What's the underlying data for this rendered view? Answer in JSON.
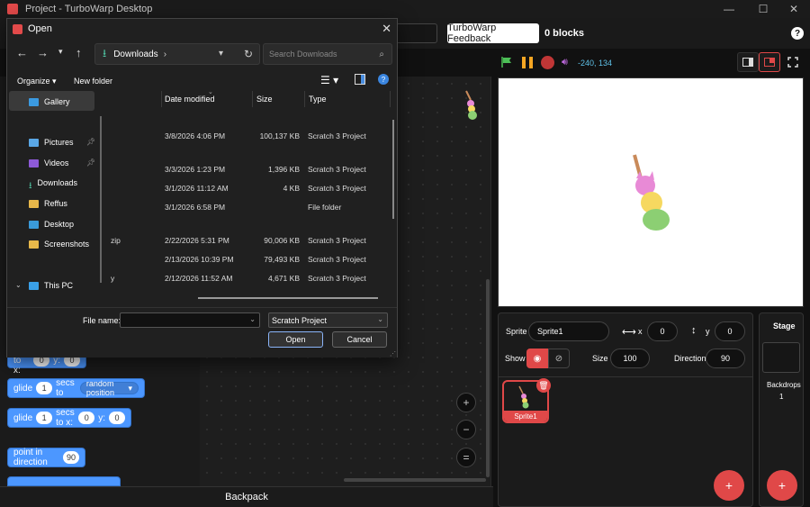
{
  "window": {
    "title": "Project - TurboWarp Desktop",
    "minimize": "—",
    "maximize": "☐",
    "close": "✕"
  },
  "menubar": {
    "feedback_label": "TurboWarp Feedback",
    "blocks_count": "0 blocks",
    "help": "?"
  },
  "stage_controls": {
    "coords": "-240, 134"
  },
  "blocks": [
    {
      "kind": "go-to-xy",
      "text": "go to x:",
      "x": "0",
      "y_label": "y:",
      "y": "0"
    },
    {
      "kind": "glide-random",
      "text_a": "glide",
      "secs": "1",
      "text_b": "secs to",
      "target": "random position"
    },
    {
      "kind": "glide-xy",
      "text_a": "glide",
      "secs": "1",
      "text_b": "secs to x:",
      "x": "0",
      "y_label": "y:",
      "y": "0"
    },
    {
      "kind": "point-direction",
      "text": "point in direction",
      "value": "90"
    }
  ],
  "zoom": {
    "in": "+",
    "out": "−",
    "reset": "="
  },
  "backpack_label": "Backpack",
  "sprite_info": {
    "sprite_label": "Sprite",
    "sprite_name": "Sprite1",
    "x_label": "x",
    "x": "0",
    "y_label": "y",
    "y": "0",
    "show_label": "Show",
    "size_label": "Size",
    "size": "100",
    "direction_label": "Direction",
    "direction": "90",
    "thumb_label": "Sprite1"
  },
  "stage_pane": {
    "title": "Stage",
    "backdrops_label": "Backdrops",
    "backdrops_count": "1"
  },
  "dialog": {
    "title": "Open",
    "address": "Downloads",
    "search_placeholder": "Search Downloads",
    "organize": "Organize",
    "new_folder": "New folder",
    "nav_items": [
      {
        "label": "Gallery",
        "icon": "gallery-icon",
        "color": "#3b9ae1",
        "pinned": false
      },
      {
        "label": "Pictures",
        "icon": "pictures-icon",
        "color": "#5aa7e6",
        "pinned": true
      },
      {
        "label": "Videos",
        "icon": "videos-icon",
        "color": "#8e5ad8",
        "pinned": true
      },
      {
        "label": "Downloads",
        "icon": "downloads-icon",
        "color": "#4fc3a1",
        "pinned": false
      },
      {
        "label": "Reffus",
        "icon": "folder-icon",
        "color": "#e8b84a",
        "pinned": false
      },
      {
        "label": "Desktop",
        "icon": "desktop-icon",
        "color": "#3a9ad9",
        "pinned": false
      },
      {
        "label": "Screenshots",
        "icon": "folder-icon",
        "color": "#e8b84a",
        "pinned": false
      },
      {
        "label": "This PC",
        "icon": "this-pc-icon",
        "color": "#3aa0e8",
        "pinned": false
      }
    ],
    "columns": {
      "date": "Date modified",
      "size": "Size",
      "type": "Type"
    },
    "rows": [
      {
        "name": "",
        "date": "3/8/2026 4:06 PM",
        "size": "100,137 KB",
        "type": "Scratch 3 Project"
      },
      {
        "name": "",
        "date": "3/3/2026 1:23 PM",
        "size": "1,396 KB",
        "type": "Scratch 3 Project"
      },
      {
        "name": "",
        "date": "3/1/2026 11:12 AM",
        "size": "4 KB",
        "type": "Scratch 3 Project"
      },
      {
        "name": "",
        "date": "3/1/2026 6:58 PM",
        "size": "",
        "type": "File folder"
      },
      {
        "name": "zip",
        "date": "2/22/2026 5:31 PM",
        "size": "90,006 KB",
        "type": "Scratch 3 Project"
      },
      {
        "name": "",
        "date": "2/13/2026 10:39 PM",
        "size": "79,493 KB",
        "type": "Scratch 3 Project"
      },
      {
        "name": "y",
        "date": "2/12/2026 11:52 AM",
        "size": "4,671 KB",
        "type": "Scratch 3 Project"
      }
    ],
    "file_name_label": "File name:",
    "file_name_value": "",
    "file_type": "Scratch Project",
    "open_label": "Open",
    "cancel_label": "Cancel"
  }
}
